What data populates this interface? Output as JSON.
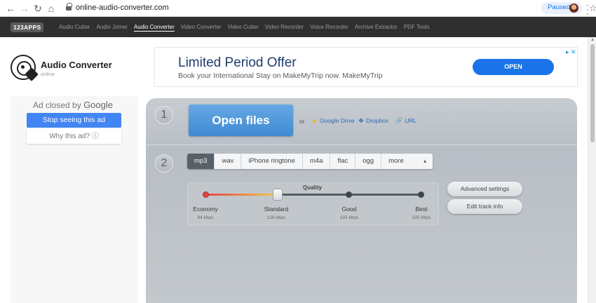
{
  "browser": {
    "url": "online-audio-converter.com",
    "paused_label": "Paused"
  },
  "appbar": {
    "brand": "123APPS",
    "links": [
      "Audio Cutter",
      "Audio Joiner",
      "Audio Converter",
      "Video Converter",
      "Video Cutter",
      "Video Recorder",
      "Voice Recorder",
      "Archive Extractor",
      "PDF Tools"
    ],
    "active": "Audio Converter"
  },
  "header": {
    "title": "Audio Converter",
    "subtitle": "online"
  },
  "top_ad": {
    "title": "Limited Period Offer",
    "text": "Book your International Stay on MakeMyTrip now. MakeMyTrip",
    "button": "OPEN"
  },
  "side_ad": {
    "closed_prefix": "Ad closed by",
    "closed_brand": "Google",
    "stop_label": "Stop seeing this ad",
    "why_label": "Why this ad? ⓘ"
  },
  "converter": {
    "step1": "1",
    "step2": "2",
    "open_files": "Open files",
    "or": "or",
    "sources": [
      "Google Drive",
      "Dropbox",
      "URL"
    ],
    "formats": [
      "mp3",
      "wav",
      "iPhone ringtone",
      "m4a",
      "flac",
      "ogg",
      "more"
    ],
    "selected_format": "mp3",
    "quality_title": "Quality",
    "quality_levels": [
      {
        "label": "Economy",
        "kbps": "64 kbps"
      },
      {
        "label": "Standard",
        "kbps": "128 kbps"
      },
      {
        "label": "Good",
        "kbps": "192 kbps"
      },
      {
        "label": "Best",
        "kbps": "320 kbps"
      }
    ],
    "selected_quality_index": 1,
    "advanced_settings": "Advanced settings",
    "edit_track_info": "Edit track info"
  },
  "colors": {
    "accent": "#1a73e8",
    "open_button": "#4a93d8",
    "appbar": "#2f2f2f"
  }
}
